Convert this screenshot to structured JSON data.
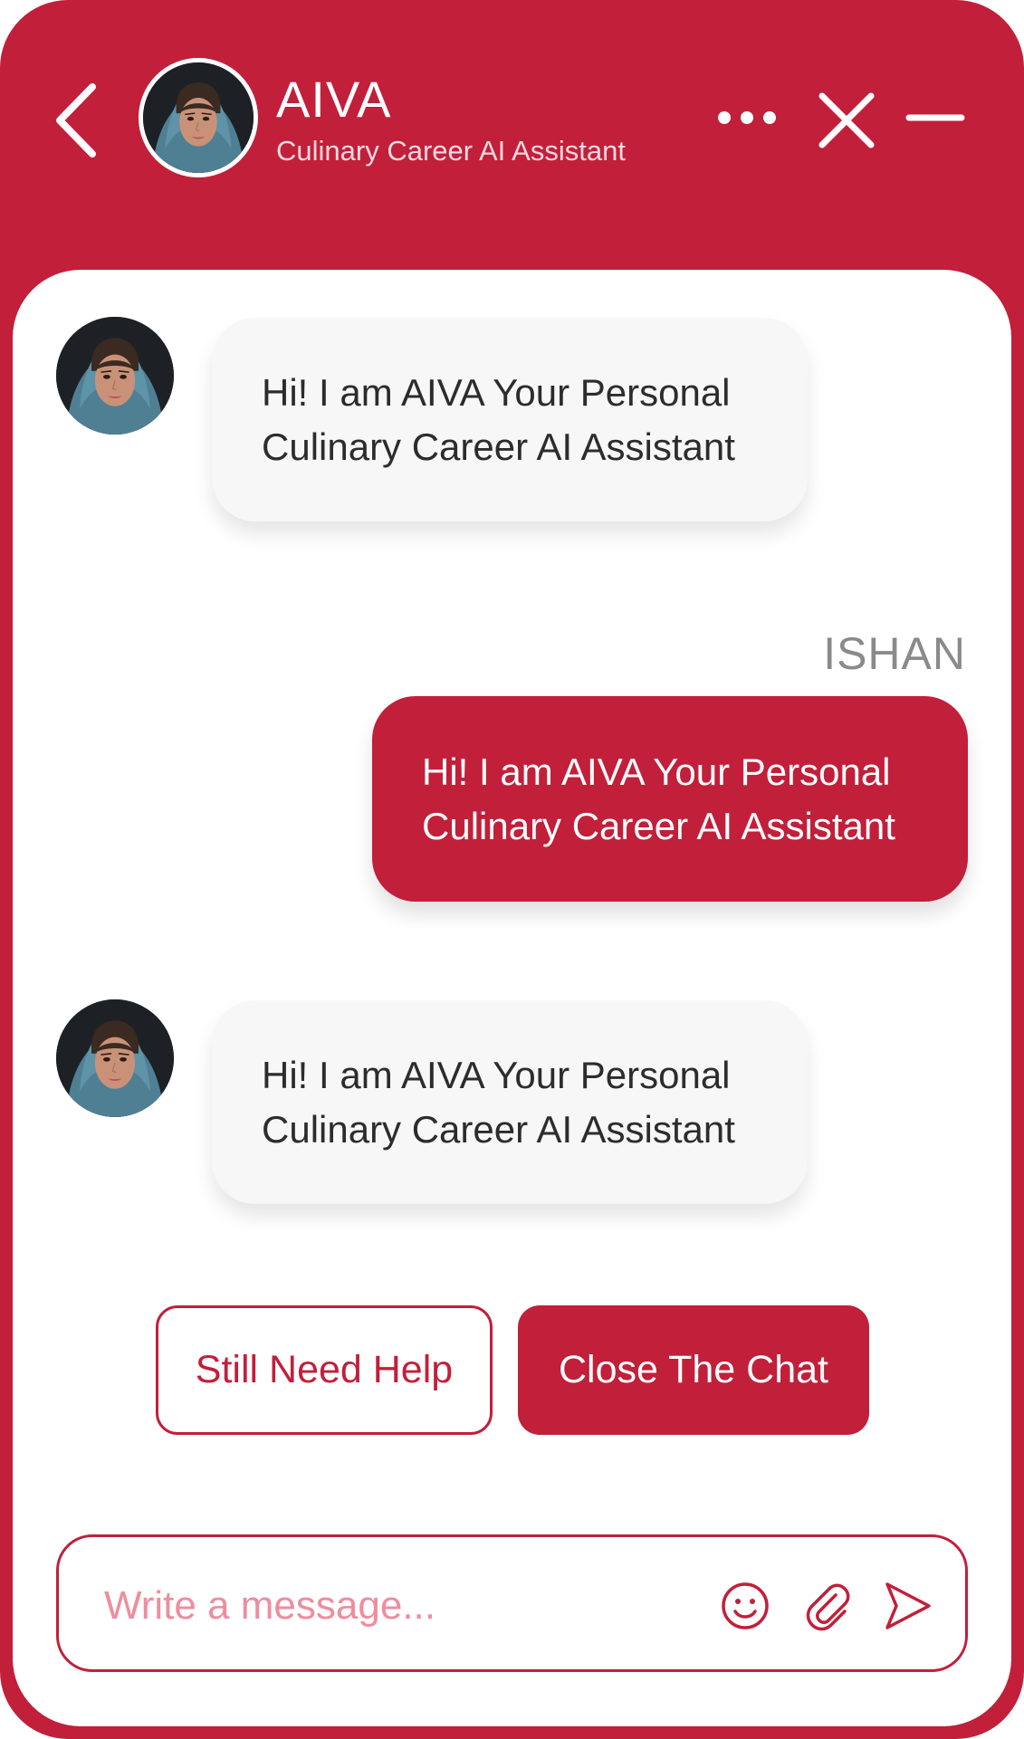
{
  "colors": {
    "brand": "#C21F3A",
    "bot_bubble": "#F7F7F7",
    "placeholder": "#EE8D9E"
  },
  "header": {
    "title": "AIVA",
    "subtitle": "Culinary Career AI Assistant",
    "icons": [
      "back-arrow-icon",
      "more-options-icon",
      "close-icon",
      "minimize-icon"
    ]
  },
  "messages": [
    {
      "sender": "bot",
      "lines": [
        "Hi! I am AIVA Your Personal",
        "Culinary Career AI Assistant"
      ]
    },
    {
      "sender": "user",
      "name": "ISHAN",
      "lines": [
        "Hi! I am AIVA Your Personal",
        "Culinary Career AI Assistant"
      ]
    },
    {
      "sender": "bot",
      "lines": [
        "Hi! I am AIVA Your Personal",
        "Culinary Career AI Assistant"
      ]
    }
  ],
  "actions": {
    "still_need_help": "Still Need Help",
    "close_chat": "Close The Chat"
  },
  "composer": {
    "placeholder": "Write a message...",
    "value": "",
    "icons": [
      "emoji-icon",
      "attachment-icon",
      "send-icon"
    ]
  }
}
